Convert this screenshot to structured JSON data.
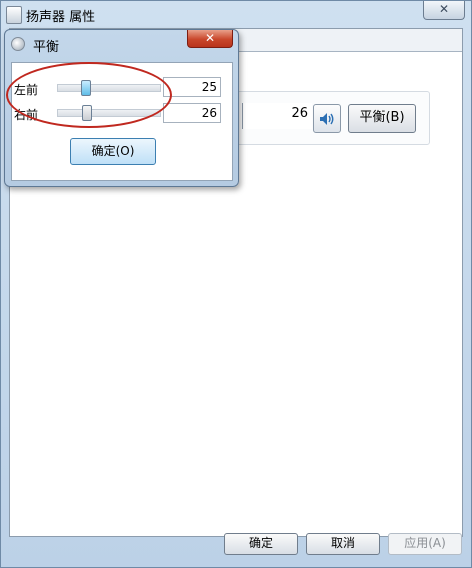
{
  "main_window": {
    "title": "扬声器 属性",
    "close_glyph": "✕",
    "level_value": "26",
    "balance_button_label": "平衡(B)",
    "footer": {
      "ok_label": "确定",
      "cancel_label": "取消",
      "apply_label": "应用(A)"
    }
  },
  "balance_dialog": {
    "title": "平衡",
    "close_glyph": "✕",
    "channels": [
      {
        "label": "左前",
        "value": "25",
        "level": 25
      },
      {
        "label": "右前",
        "value": "26",
        "level": 26
      }
    ],
    "ok_label": "确定(O)"
  },
  "icons": {
    "app": "speaker-properties-icon",
    "dialog": "balance-icon",
    "speaker": "speaker-icon",
    "close": "close-icon"
  },
  "colors": {
    "highlight": "#c0281f",
    "close_button": "#c9472b",
    "window_frame": "#bcd1e7"
  }
}
